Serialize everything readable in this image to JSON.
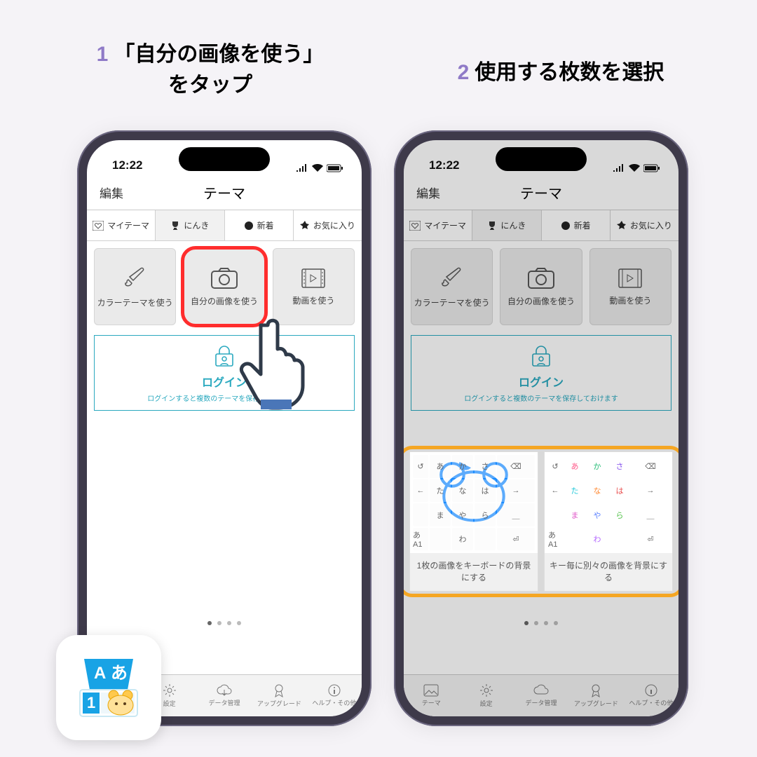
{
  "canvas": {
    "caption_left_num": "1",
    "caption_left": "「自分の画像を使う」\nをタップ",
    "caption_right_num": "2",
    "caption_right": "使用する枚数を選択"
  },
  "status": {
    "time": "12:22"
  },
  "navbar": {
    "edit": "編集",
    "title": "テーマ"
  },
  "segtabs": {
    "mytheme": "マイテーマ",
    "popular": "にんき",
    "new": "新着",
    "favorite": "お気に入り"
  },
  "option_cards": {
    "color": "カラーテーマを使う",
    "own_image": "自分の画像を使う",
    "video": "動画を使う"
  },
  "login": {
    "title": "ログイン",
    "sub": "ログインすると複数のテーマを保存しておけます"
  },
  "tabbar": {
    "theme": "テーマ",
    "settings": "設定",
    "data": "データ管理",
    "upgrade": "アップグレード",
    "help": "ヘルプ・その他"
  },
  "choice_panel": {
    "opt1": "1枚の画像をキーボードの背景にする",
    "opt2": "キー毎に別々の画像を背景にする"
  },
  "kana": {
    "r1": [
      "あ",
      "か",
      "さ"
    ],
    "r2": [
      "た",
      "な",
      "は"
    ],
    "r3": [
      "ま",
      "や",
      "ら"
    ],
    "r4": [
      "",
      "わ",
      ""
    ],
    "mode": "あA1"
  },
  "arrows": {
    "left": "←",
    "right": "→",
    "undo": "↺",
    "back": "⌫",
    "space": "␣",
    "enter": "⏎",
    "underscore": "＿"
  }
}
